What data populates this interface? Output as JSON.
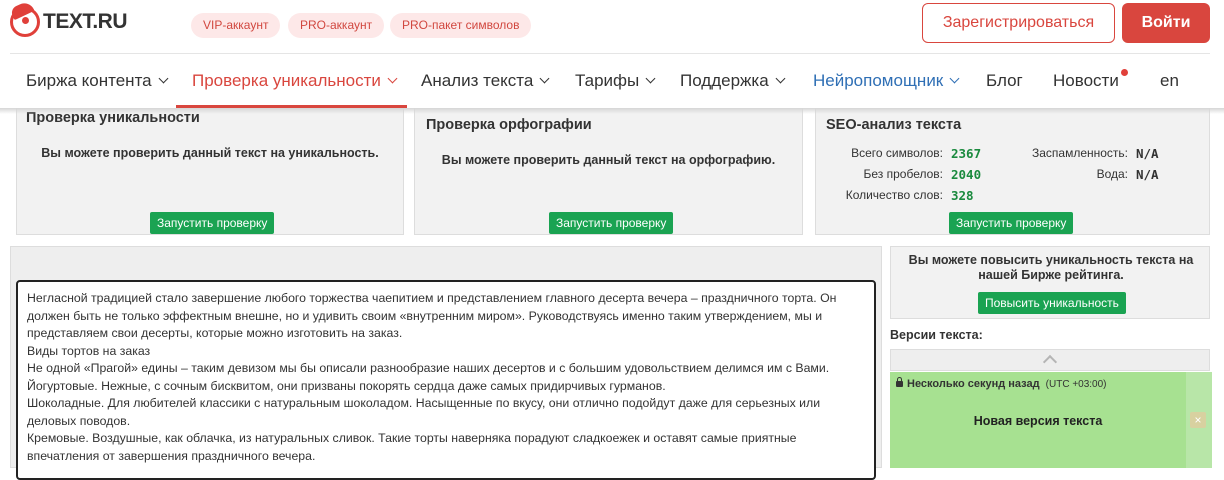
{
  "header": {
    "logo_text": "TEXT.RU",
    "pills": [
      "VIP-аккаунт",
      "PRO-аккаунт",
      "PRO-пакет символов"
    ],
    "register_label": "Зарегистрироваться",
    "login_label": "Войти",
    "brand_color": "#d9463e"
  },
  "nav": {
    "items": [
      "Биржа контента",
      "Проверка уникальности",
      "Анализ текста",
      "Тарифы",
      "Поддержка",
      "Нейропомощник",
      "Блог",
      "Новости",
      "en"
    ],
    "active": "Проверка уникальности"
  },
  "panels": {
    "uniqueness": {
      "title": "Проверка уникальности",
      "message": "Вы можете проверить данный текст на уникальность.",
      "button": "Запустить проверку"
    },
    "spelling": {
      "title": "Проверка орфографии",
      "message": "Вы можете проверить данный текст на орфографию.",
      "button": "Запустить проверку"
    },
    "seo": {
      "title": "SEO-анализ текста",
      "left": [
        {
          "label": "Всего символов:",
          "value": "2367"
        },
        {
          "label": "Без пробелов:",
          "value": "2040"
        },
        {
          "label": "Количество слов:",
          "value": "328"
        }
      ],
      "right": [
        {
          "label": "Заспамленность:",
          "value": "N/A"
        },
        {
          "label": "Вода:",
          "value": "N/A"
        }
      ],
      "button": "Запустить проверку"
    }
  },
  "sidebar": {
    "promo_message": "Вы можете повысить уникальность текста на нашей Бирже рейтинга.",
    "promo_button": "Повысить уникальность",
    "versions_title": "Версии текста:",
    "version_time": "Несколько секунд назад",
    "version_tz": "(UTC +03:00)",
    "version_label": "Новая версия текста",
    "close_glyph": "×"
  },
  "text_lines": [
    "Негласной традицией стало завершение любого торжества чаепитием и представлением главного десерта вечера – праздничного торта. Он должен быть не только эффектным внешне, но и удивить своим «внутренним миром». Руководствуясь именно таким утверждением, мы и представляем свои десерты, которые можно изготовить на заказ.",
    "Виды тортов на заказ",
    "Не одной «Прагой» едины – таким девизом мы бы описали разнообразие наших десертов и с большим удовольствием делимся им с Вами.",
    "Йогуртовые. Нежные, с сочным бисквитом, они призваны покорять сердца даже самых придирчивых гурманов.",
    "Шоколадные. Для любителей классики с натуральным шоколадом. Насыщенные по вкусу, они отлично подойдут даже для серьезных или деловых поводов.",
    "Кремовые. Воздушные, как облачка, из натуральных сливок. Такие торты наверняка порадуют сладкоежек и оставят самые приятные впечатления от завершения праздничного вечера."
  ]
}
